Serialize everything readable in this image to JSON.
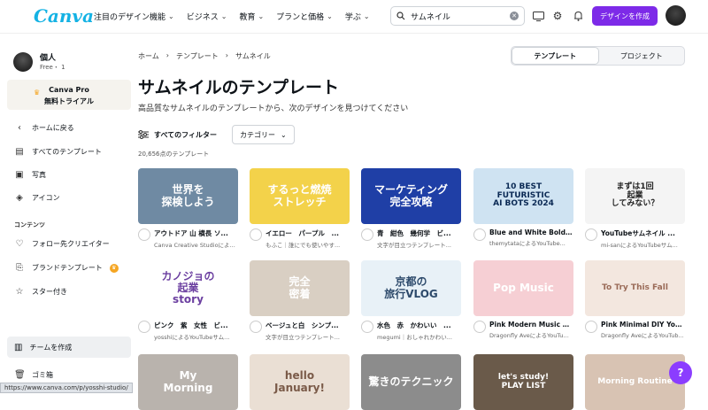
{
  "app": {
    "logo": "Canva"
  },
  "nav": [
    {
      "label": "注目のデザイン機能"
    },
    {
      "label": "ビジネス"
    },
    {
      "label": "教育"
    },
    {
      "label": "プランと価格"
    },
    {
      "label": "学ぶ"
    }
  ],
  "search": {
    "value": "サムネイル"
  },
  "header": {
    "create_label": "デザインを作成"
  },
  "profile": {
    "name": "個人",
    "plan": "Free・ 1"
  },
  "pro": {
    "line1": "Canva Pro",
    "line2": "無料トライアル"
  },
  "sidebar": {
    "items": [
      {
        "label": "ホームに戻る"
      },
      {
        "label": "すべてのテンプレート"
      },
      {
        "label": "写真"
      },
      {
        "label": "アイコン"
      }
    ],
    "section_label": "コンテンツ",
    "content_items": [
      {
        "label": "フォロー先クリエイター"
      },
      {
        "label": "ブランドテンプレート"
      },
      {
        "label": "スター付き"
      }
    ],
    "team_label": "チームを作成",
    "trash_label": "ゴミ箱"
  },
  "status_url": "https://www.canva.com/p/yosshi-studio/",
  "breadcrumb": [
    "ホーム",
    "テンプレート",
    "サムネイル"
  ],
  "segment": {
    "templates": "テンプレート",
    "projects": "プロジェクト"
  },
  "page": {
    "title": "サムネイルのテンプレート",
    "description": "高品質なサムネイルのテンプレートから、次のデザインを見つけてください",
    "filter_all": "すべてのフィルター",
    "filter_category": "カテゴリー",
    "count": "20,656点のテンプレート"
  },
  "cards": [
    {
      "title": "アウトドア 山 横長 ソ...",
      "author": "Canva Creative Studioによ...",
      "thumb_text": "世界を\n探検しよう",
      "bg": "#6f8aa3",
      "fg": "#ffffff"
    },
    {
      "title": "イエロー　パープル　...",
      "author": "もふこ｜誰にでも使いやす...",
      "thumb_text": "するっと燃焼\nストレッチ",
      "bg": "#f3d24a",
      "fg": "#ffffff"
    },
    {
      "title": "青　紺色　幾何学　ビ...",
      "author": "文字が目立つテンプレート...",
      "thumb_text": "マーケティング\n完全攻略",
      "bg": "#1f3fa6",
      "fg": "#ffffff"
    },
    {
      "title": "Blue and White Bold ...",
      "author": "themytataによるYouTube...",
      "thumb_text": "10 BEST\nFUTURISTIC\nAI BOTS 2024",
      "bg": "#cfe3f2",
      "fg": "#0b2a55"
    },
    {
      "title": "YouTubeサムネイル ...",
      "author": "mi-sanによるYouTubeサム...",
      "thumb_text": "まずは1回\n起業\nしてみない？",
      "bg": "#f4f4f4",
      "fg": "#222222"
    },
    {
      "title": "ピンク　紫　女性　ビ...",
      "author": "yosshiによるYouTubeサム...",
      "thumb_text": "カノジョの\n起業\nstory",
      "bg": "#ffffff",
      "fg": "#6b3fa0"
    },
    {
      "title": "ベージュと白　シンプ...",
      "author": "文字が目立つテンプレート...",
      "thumb_text": "完全\n密着",
      "bg": "#d9cfc3",
      "fg": "#ffffff"
    },
    {
      "title": "水色　赤　かわいい　...",
      "author": "megumi｜おしゃれかわい...",
      "thumb_text": "京都の\n旅行VLOG",
      "bg": "#e8f1f7",
      "fg": "#2d4a6b"
    },
    {
      "title": "Pink Modern Music Y...",
      "author": "Dragonfly AveによるYouTube...",
      "thumb_text": "Pop Music",
      "bg": "#f6cfd4",
      "fg": "#ffffff"
    },
    {
      "title": "Pink Minimal DIY You...",
      "author": "Dragonfly AveによるYouTub...",
      "thumb_text": "To Try This Fall",
      "bg": "#f3e7df",
      "fg": "#9a6b58"
    },
    {
      "title": "",
      "author": "",
      "thumb_text": "My\nMorning",
      "bg": "#b9b3ad",
      "fg": "#ffffff"
    },
    {
      "title": "",
      "author": "",
      "thumb_text": "hello\nJanuary!",
      "bg": "#eadfd4",
      "fg": "#7a5a48"
    },
    {
      "title": "",
      "author": "",
      "thumb_text": "驚きのテクニック",
      "bg": "#8c8c8c",
      "fg": "#ffffff"
    },
    {
      "title": "",
      "author": "",
      "thumb_text": "let's study!\nPLAY LIST",
      "bg": "#6a5a4a",
      "fg": "#ffffff"
    },
    {
      "title": "",
      "author": "",
      "thumb_text": "Morning Routine",
      "bg": "#d8c3b3",
      "fg": "#ffffff"
    }
  ]
}
